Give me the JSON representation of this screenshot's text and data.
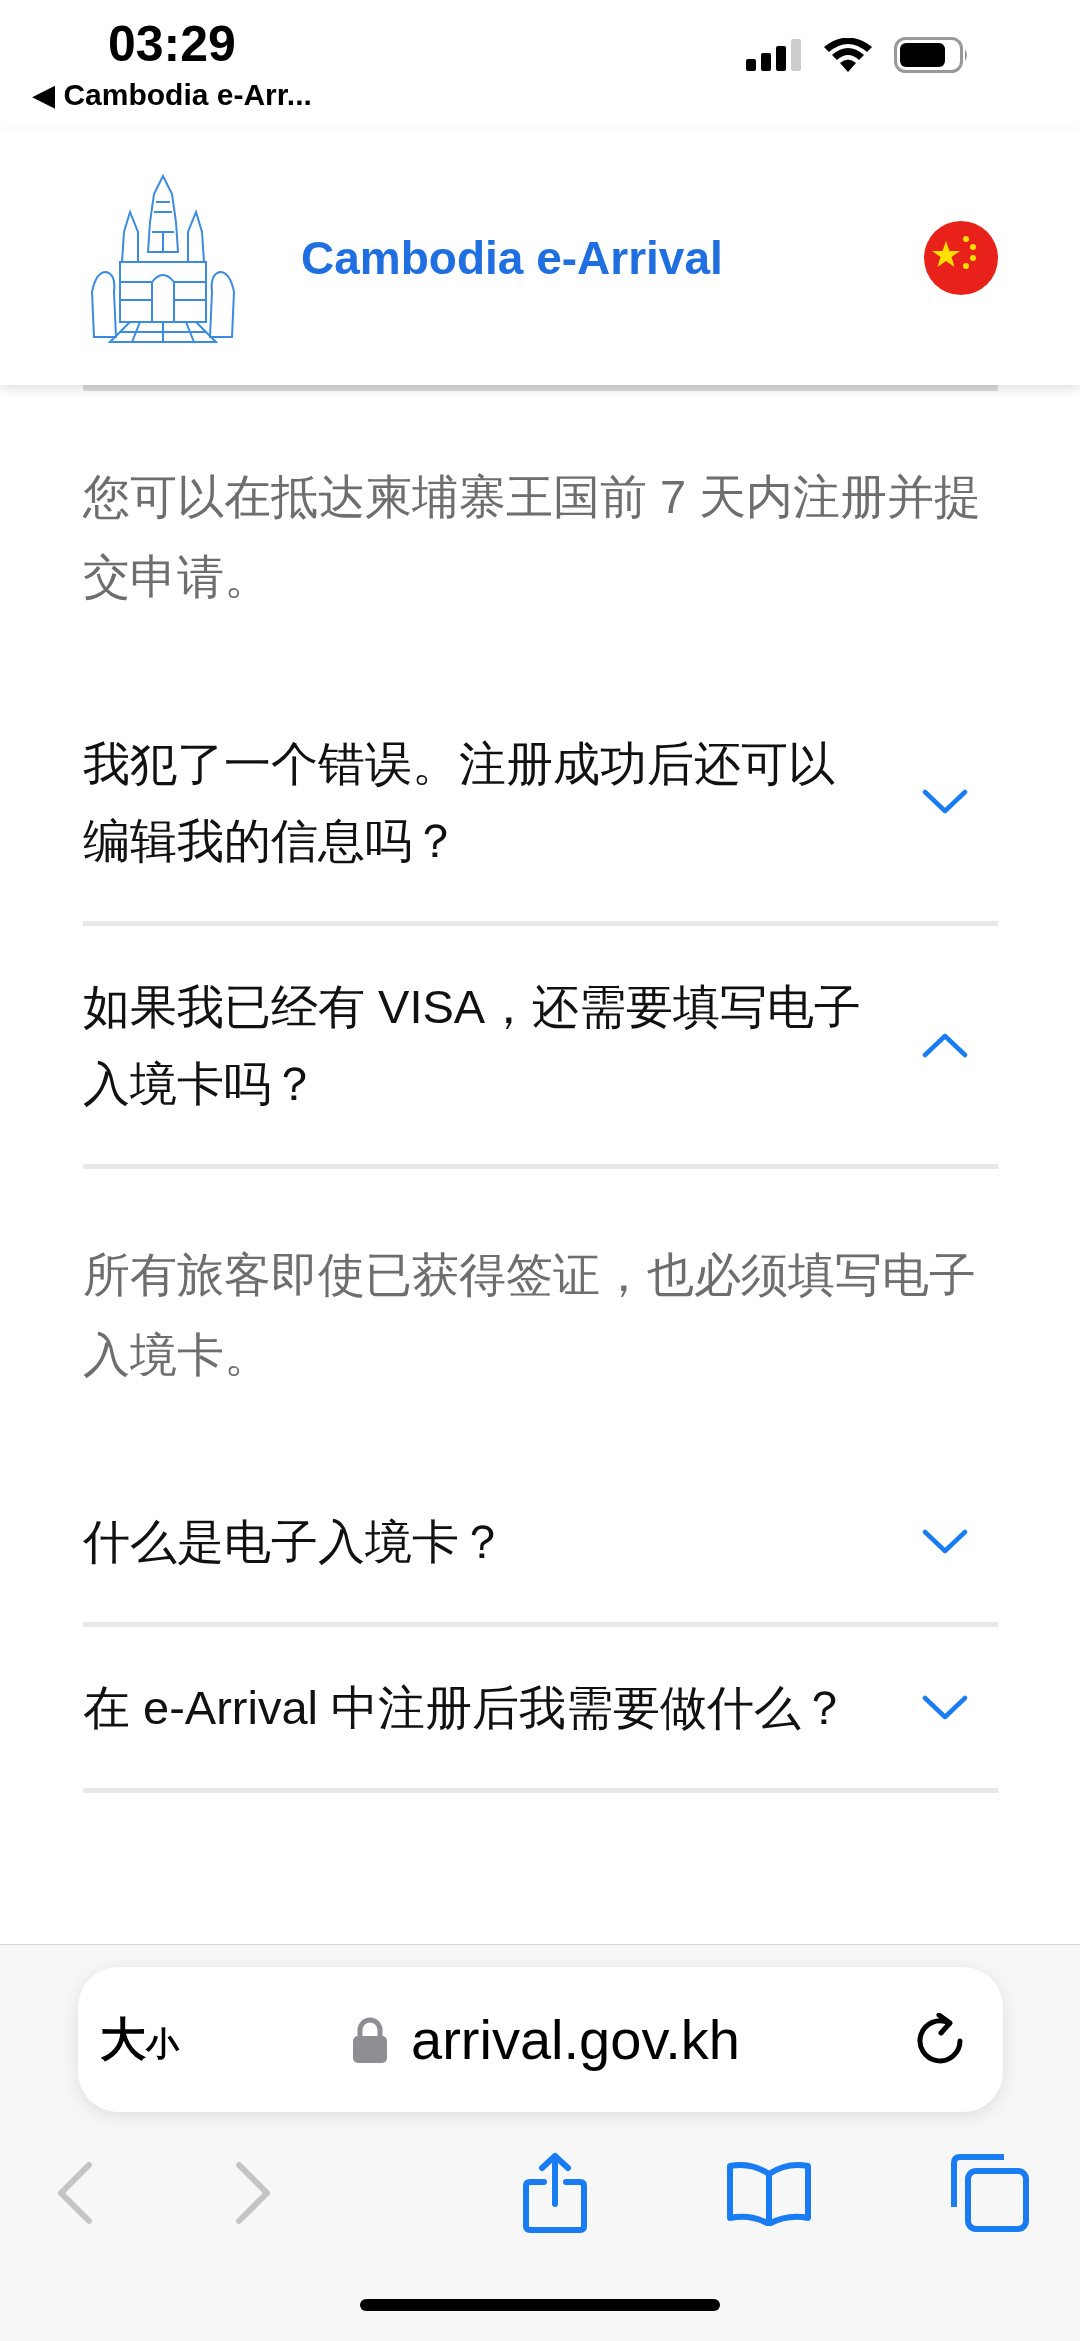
{
  "status_bar": {
    "time": "03:29",
    "back_label": "◀ Cambodia e-Arr..."
  },
  "header": {
    "title": "Cambodia e-Arrival"
  },
  "faq": {
    "answer_above": "您可以在抵达柬埔寨王国前 7 天内注册并提交申请。",
    "items": [
      {
        "question": "我犯了一个错误。注册成功后还可以编辑我的信息吗？",
        "expanded": false
      },
      {
        "question": "如果我已经有 VISA，还需要填写电子入境卡吗？",
        "expanded": true,
        "answer": "所有旅客即使已获得签证，也必须填写电子入境卡。"
      },
      {
        "question": "什么是电子入境卡？",
        "expanded": false
      },
      {
        "question": "在 e-Arrival 中注册后我需要做什么？",
        "expanded": false
      }
    ]
  },
  "browser": {
    "text_size": {
      "big": "大",
      "small": "小"
    },
    "url": "arrival.gov.kh",
    "back_disabled": true,
    "forward_disabled": true
  }
}
